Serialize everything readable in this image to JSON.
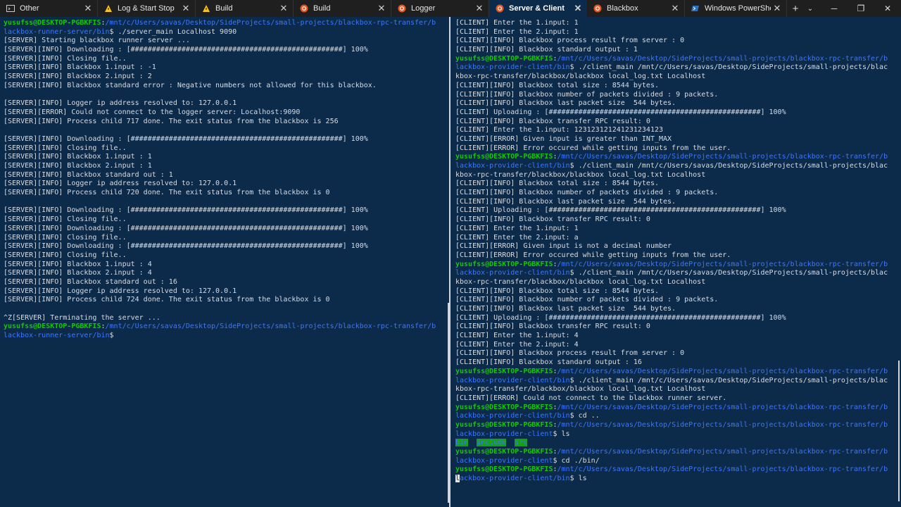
{
  "tabs": [
    {
      "label": "Other",
      "icon": "terminal-icon",
      "active": false
    },
    {
      "label": "Log & Start Stop",
      "icon": "linux-icon",
      "active": false
    },
    {
      "label": "Build",
      "icon": "linux-icon",
      "active": false
    },
    {
      "label": "Build",
      "icon": "ubuntu-icon",
      "active": false
    },
    {
      "label": "Logger",
      "icon": "ubuntu-icon",
      "active": false
    },
    {
      "label": "Server & Client",
      "icon": "ubuntu-icon",
      "active": true
    },
    {
      "label": "Blackbox",
      "icon": "ubuntu-icon",
      "active": false
    },
    {
      "label": "Windows PowerShell",
      "icon": "powershell-icon",
      "active": false
    }
  ],
  "tab_close_glyph": "✕",
  "newtab_glyph": "+",
  "dropdown_glyph": "⌄",
  "window_controls": {
    "minimize": "─",
    "maximize": "❐",
    "close": "✕"
  },
  "left_pane": [
    [
      {
        "t": "yusufss@DESKTOP-PGBKFIS",
        "c": "prompt-user"
      },
      {
        "t": ":"
      },
      {
        "t": "/mnt/c/Users/savas/Desktop/SideProjects/small-projects/blackbox-rpc-transfer/b",
        "c": "prompt-path"
      }
    ],
    [
      {
        "t": "lackbox-runner-server/bin",
        "c": "prompt-path"
      },
      {
        "t": "$ ./server_main Localhost 9090"
      }
    ],
    [
      {
        "t": "[SERVER] Starting blackbox runner server ..."
      }
    ],
    [
      {
        "t": "[SERVER][INFO] Downloading : [##################################################] 100%"
      }
    ],
    [
      {
        "t": "[SERVER][INFO] Closing file.."
      }
    ],
    [
      {
        "t": "[SERVER][INFO] Blackbox 1.input : -1"
      }
    ],
    [
      {
        "t": "[SERVER][INFO] Blackbox 2.input : 2"
      }
    ],
    [
      {
        "t": "[SERVER][INFO] Blackbox standard error : Negative numbers not allowed for this blackbox."
      }
    ],
    [
      {
        "t": ""
      }
    ],
    [
      {
        "t": "[SERVER][INFO] Logger ip address resolved to: 127.0.0.1"
      }
    ],
    [
      {
        "t": "[SERVER][ERROR] Could not connect to the logger server: Localhost:9090"
      }
    ],
    [
      {
        "t": "[SERVER][INFO] Process child 717 done. The exit status from the blackbox is 256"
      }
    ],
    [
      {
        "t": ""
      }
    ],
    [
      {
        "t": "[SERVER][INFO] Downloading : [##################################################] 100%"
      }
    ],
    [
      {
        "t": "[SERVER][INFO] Closing file.."
      }
    ],
    [
      {
        "t": "[SERVER][INFO] Blackbox 1.input : 1"
      }
    ],
    [
      {
        "t": "[SERVER][INFO] Blackbox 2.input : 1"
      }
    ],
    [
      {
        "t": "[SERVER][INFO] Blackbox standard out : 1"
      }
    ],
    [
      {
        "t": "[SERVER][INFO] Logger ip address resolved to: 127.0.0.1"
      }
    ],
    [
      {
        "t": "[SERVER][INFO] Process child 720 done. The exit status from the blackbox is 0"
      }
    ],
    [
      {
        "t": ""
      }
    ],
    [
      {
        "t": "[SERVER][INFO] Downloading : [##################################################] 100%"
      }
    ],
    [
      {
        "t": "[SERVER][INFO] Closing file.."
      }
    ],
    [
      {
        "t": "[SERVER][INFO] Downloading : [##################################################] 100%"
      }
    ],
    [
      {
        "t": "[SERVER][INFO] Closing file.."
      }
    ],
    [
      {
        "t": "[SERVER][INFO] Downloading : [##################################################] 100%"
      }
    ],
    [
      {
        "t": "[SERVER][INFO] Closing file.."
      }
    ],
    [
      {
        "t": "[SERVER][INFO] Blackbox 1.input : 4"
      }
    ],
    [
      {
        "t": "[SERVER][INFO] Blackbox 2.input : 4"
      }
    ],
    [
      {
        "t": "[SERVER][INFO] Blackbox standard out : 16"
      }
    ],
    [
      {
        "t": "[SERVER][INFO] Logger ip address resolved to: 127.0.0.1"
      }
    ],
    [
      {
        "t": "[SERVER][INFO] Process child 724 done. The exit status from the blackbox is 0"
      }
    ],
    [
      {
        "t": ""
      }
    ],
    [
      {
        "t": "^Z[SERVER] Terminating the server ..."
      }
    ],
    [
      {
        "t": "yusufss@DESKTOP-PGBKFIS",
        "c": "prompt-user"
      },
      {
        "t": ":"
      },
      {
        "t": "/mnt/c/Users/savas/Desktop/SideProjects/small-projects/blackbox-rpc-transfer/b",
        "c": "prompt-path"
      }
    ],
    [
      {
        "t": "lackbox-runner-server/bin",
        "c": "prompt-path"
      },
      {
        "t": "$"
      }
    ]
  ],
  "right_pane": [
    [
      {
        "t": "[CLIENT] Enter the 1.input: 1"
      }
    ],
    [
      {
        "t": "[CLIENT] Enter the 2.input: 1"
      }
    ],
    [
      {
        "t": "[CLIENT][INFO] Blackbox process result from server : 0"
      }
    ],
    [
      {
        "t": "[CLIENT][INFO] Blackbox standard output : 1"
      }
    ],
    [
      {
        "t": "yusufss@DESKTOP-PGBKFIS",
        "c": "prompt-user"
      },
      {
        "t": ":"
      },
      {
        "t": "/mnt/c/Users/savas/Desktop/SideProjects/small-projects/blackbox-rpc-transfer/b",
        "c": "prompt-path"
      }
    ],
    [
      {
        "t": "lackbox-provider-client/bin",
        "c": "prompt-path"
      },
      {
        "t": "$ ./client_main /mnt/c/Users/savas/Desktop/SideProjects/small-projects/blac"
      }
    ],
    [
      {
        "t": "kbox-rpc-transfer/blackbox/blackbox local_log.txt Localhost"
      }
    ],
    [
      {
        "t": "[CLIENT][INFO] Blackbox total size : 8544 bytes."
      }
    ],
    [
      {
        "t": "[CLIENT][INFO] Blackbox number of packets divided : 9 packets."
      }
    ],
    [
      {
        "t": "[CLIENT][INFO] Blackbox last packet size  544 bytes."
      }
    ],
    [
      {
        "t": "[CLIENT] Uploading : [##################################################] 100%"
      }
    ],
    [
      {
        "t": "[CLIENT][INFO] Blackbox transfer RPC result: 0"
      }
    ],
    [
      {
        "t": "[CLIENT] Enter the 1.input: 123123121241231234123"
      }
    ],
    [
      {
        "t": "[CLIENT][ERROR] Given input is greater than INT_MAX"
      }
    ],
    [
      {
        "t": "[CLIENT][ERROR] Error occured while getting inputs from the user."
      }
    ],
    [
      {
        "t": "yusufss@DESKTOP-PGBKFIS",
        "c": "prompt-user"
      },
      {
        "t": ":"
      },
      {
        "t": "/mnt/c/Users/savas/Desktop/SideProjects/small-projects/blackbox-rpc-transfer/b",
        "c": "prompt-path"
      }
    ],
    [
      {
        "t": "lackbox-provider-client/bin",
        "c": "prompt-path"
      },
      {
        "t": "$ ./client_main /mnt/c/Users/savas/Desktop/SideProjects/small-projects/blac"
      }
    ],
    [
      {
        "t": "kbox-rpc-transfer/blackbox/blackbox local_log.txt Localhost"
      }
    ],
    [
      {
        "t": "[CLIENT][INFO] Blackbox total size : 8544 bytes."
      }
    ],
    [
      {
        "t": "[CLIENT][INFO] Blackbox number of packets divided : 9 packets."
      }
    ],
    [
      {
        "t": "[CLIENT][INFO] Blackbox last packet size  544 bytes."
      }
    ],
    [
      {
        "t": "[CLIENT] Uploading : [##################################################] 100%"
      }
    ],
    [
      {
        "t": "[CLIENT][INFO] Blackbox transfer RPC result: 0"
      }
    ],
    [
      {
        "t": "[CLIENT] Enter the 1.input: 1"
      }
    ],
    [
      {
        "t": "[CLIENT] Enter the 2.input: a"
      }
    ],
    [
      {
        "t": "[CLIENT][ERROR] Given input is not a decimal number"
      }
    ],
    [
      {
        "t": "[CLIENT][ERROR] Error occured while getting inputs from the user."
      }
    ],
    [
      {
        "t": "yusufss@DESKTOP-PGBKFIS",
        "c": "prompt-user"
      },
      {
        "t": ":"
      },
      {
        "t": "/mnt/c/Users/savas/Desktop/SideProjects/small-projects/blackbox-rpc-transfer/b",
        "c": "prompt-path"
      }
    ],
    [
      {
        "t": "lackbox-provider-client/bin",
        "c": "prompt-path"
      },
      {
        "t": "$ ./client_main /mnt/c/Users/savas/Desktop/SideProjects/small-projects/blac"
      }
    ],
    [
      {
        "t": "kbox-rpc-transfer/blackbox/blackbox local_log.txt Localhost"
      }
    ],
    [
      {
        "t": "[CLIENT][INFO] Blackbox total size : 8544 bytes."
      }
    ],
    [
      {
        "t": "[CLIENT][INFO] Blackbox number of packets divided : 9 packets."
      }
    ],
    [
      {
        "t": "[CLIENT][INFO] Blackbox last packet size  544 bytes."
      }
    ],
    [
      {
        "t": "[CLIENT] Uploading : [##################################################] 100%"
      }
    ],
    [
      {
        "t": "[CLIENT][INFO] Blackbox transfer RPC result: 0"
      }
    ],
    [
      {
        "t": "[CLIENT] Enter the 1.input: 4"
      }
    ],
    [
      {
        "t": "[CLIENT] Enter the 2.input: 4"
      }
    ],
    [
      {
        "t": "[CLIENT][INFO] Blackbox process result from server : 0"
      }
    ],
    [
      {
        "t": "[CLIENT][INFO] Blackbox standard output : 16"
      }
    ],
    [
      {
        "t": "yusufss@DESKTOP-PGBKFIS",
        "c": "prompt-user"
      },
      {
        "t": ":"
      },
      {
        "t": "/mnt/c/Users/savas/Desktop/SideProjects/small-projects/blackbox-rpc-transfer/b",
        "c": "prompt-path"
      }
    ],
    [
      {
        "t": "lackbox-provider-client/bin",
        "c": "prompt-path"
      },
      {
        "t": "$ ./client_main /mnt/c/Users/savas/Desktop/SideProjects/small-projects/blac"
      }
    ],
    [
      {
        "t": "kbox-rpc-transfer/blackbox/blackbox local_log.txt Localhost"
      }
    ],
    [
      {
        "t": "[CLIENT][ERROR] Could not connect to the blackbox runner server."
      }
    ],
    [
      {
        "t": "yusufss@DESKTOP-PGBKFIS",
        "c": "prompt-user"
      },
      {
        "t": ":"
      },
      {
        "t": "/mnt/c/Users/savas/Desktop/SideProjects/small-projects/blackbox-rpc-transfer/b",
        "c": "prompt-path"
      }
    ],
    [
      {
        "t": "lackbox-provider-client/bin",
        "c": "prompt-path"
      },
      {
        "t": "$ cd .."
      }
    ],
    [
      {
        "t": "yusufss@DESKTOP-PGBKFIS",
        "c": "prompt-user"
      },
      {
        "t": ":"
      },
      {
        "t": "/mnt/c/Users/savas/Desktop/SideProjects/small-projects/blackbox-rpc-transfer/b",
        "c": "prompt-path"
      }
    ],
    [
      {
        "t": "lackbox-provider-client",
        "c": "prompt-path"
      },
      {
        "t": "$ ls"
      }
    ],
    [
      {
        "t": "bin",
        "c": "hl"
      },
      {
        "t": "  "
      },
      {
        "t": "include",
        "c": "hl"
      },
      {
        "t": "  "
      },
      {
        "t": "src",
        "c": "hl"
      }
    ],
    [
      {
        "t": "yusufss@DESKTOP-PGBKFIS",
        "c": "prompt-user"
      },
      {
        "t": ":"
      },
      {
        "t": "/mnt/c/Users/savas/Desktop/SideProjects/small-projects/blackbox-rpc-transfer/b",
        "c": "prompt-path"
      }
    ],
    [
      {
        "t": "lackbox-provider-client",
        "c": "prompt-path"
      },
      {
        "t": "$ cd ./bin/"
      }
    ],
    [
      {
        "t": "yusufss@DESKTOP-PGBKFIS",
        "c": "prompt-user"
      },
      {
        "t": ":"
      },
      {
        "t": "/mnt/c/Users/savas/Desktop/SideProjects/small-projects/blackbox-rpc-transfer/b",
        "c": "prompt-path"
      }
    ],
    [
      {
        "t": "l",
        "c": "cursor"
      },
      {
        "t": "ackbox-provider-client/bin",
        "c": "prompt-path"
      },
      {
        "t": "$ ls"
      }
    ]
  ]
}
